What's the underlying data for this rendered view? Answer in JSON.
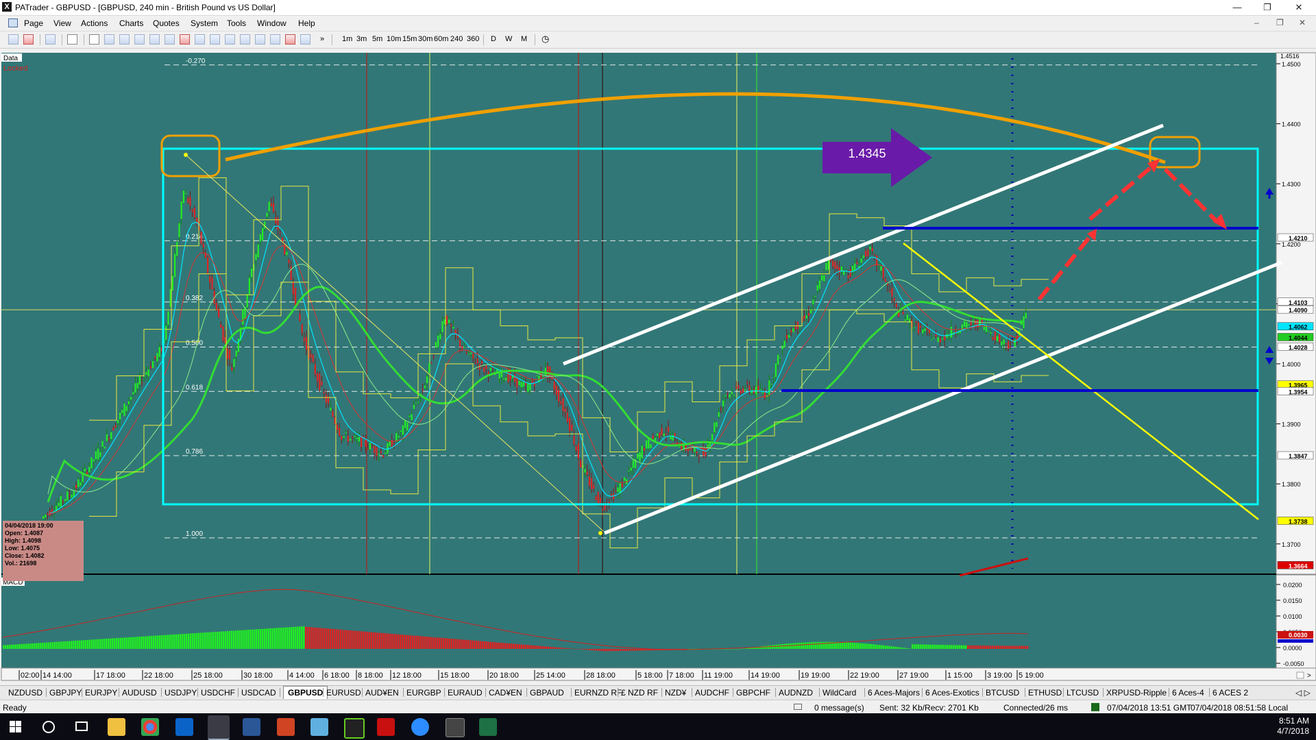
{
  "window": {
    "app_icon": "X",
    "title": "PATrader - GBPUSD - [GBPUSD, 240 min - British Pound vs US Dollar]",
    "controls": [
      "minimize-icon",
      "restore-icon",
      "close-icon"
    ]
  },
  "menu": [
    "Page",
    "View",
    "Actions",
    "Charts",
    "Quotes",
    "System",
    "Tools",
    "Window",
    "Help"
  ],
  "toolbar": {
    "timeframes": [
      "1m",
      "3m",
      "5m",
      "10m",
      "15m",
      "30m",
      "60m",
      "240",
      "360"
    ],
    "periods": [
      "D",
      "W",
      "M"
    ],
    "overflow": "»"
  },
  "chart": {
    "corner_label": "Data",
    "locked_label": "Locked",
    "fib_levels": [
      {
        "label": "-0.270",
        "price": 1.4498
      },
      {
        "label": "0.214",
        "price": 1.4205
      },
      {
        "label": "0.382",
        "price": 1.4103
      },
      {
        "label": "0.500",
        "price": 1.4028
      },
      {
        "label": "0.618",
        "price": 1.3954
      },
      {
        "label": "0.786",
        "price": 1.3847
      },
      {
        "label": "1.000",
        "price": 1.371
      }
    ],
    "callout_price": "1.4345",
    "price_axis": {
      "top_value": "1.4516",
      "ticks": [
        "1.4500",
        "1.4400",
        "1.4300",
        "1.4200",
        "1.4100",
        "1.4000",
        "1.3900",
        "1.3800",
        "1.3700"
      ],
      "tick_values": [
        1.45,
        1.44,
        1.43,
        1.42,
        1.41,
        1.4,
        1.39,
        1.38,
        1.37
      ],
      "labels": [
        {
          "text": "1.4210",
          "price": 1.421,
          "bg": "#ffffff",
          "fg": "#000000"
        },
        {
          "text": "1.4103",
          "price": 1.4103,
          "bg": "#ffffff",
          "fg": "#000000"
        },
        {
          "text": "1.4090",
          "price": 1.409,
          "bg": "#ffffff",
          "fg": "#000000"
        },
        {
          "text": "1.4062",
          "price": 1.4062,
          "bg": "#00e5ff",
          "fg": "#000000"
        },
        {
          "text": "1.4044",
          "price": 1.4044,
          "bg": "#22cc22",
          "fg": "#000000"
        },
        {
          "text": "1.4028",
          "price": 1.4028,
          "bg": "#ffffff",
          "fg": "#000000"
        },
        {
          "text": "1.3965",
          "price": 1.3965,
          "bg": "#ffff00",
          "fg": "#000000"
        },
        {
          "text": "1.3954",
          "price": 1.3954,
          "bg": "#ffffff",
          "fg": "#000000"
        },
        {
          "text": "1.3847",
          "price": 1.3847,
          "bg": "#ffffff",
          "fg": "#000000"
        },
        {
          "text": "1.3738",
          "price": 1.3738,
          "bg": "#ffff00",
          "fg": "#000000"
        },
        {
          "text": "1.3664",
          "price": 1.3664,
          "bg": "#dd0000",
          "fg": "#ffffff"
        }
      ]
    },
    "info_box": {
      "date": "04/04/2018 19:00",
      "open": "Open: 1.4087",
      "high": "High: 1.4098",
      "low": "Low: 1.4075",
      "close": "Close: 1.4082",
      "volume": "Vol.: 21698"
    },
    "macd": {
      "label": "MACD",
      "ticks": [
        "0.0200",
        "0.0150",
        "0.0100",
        "0.0050",
        "0.0000",
        "-0.0050"
      ],
      "current_value": "0.0030"
    },
    "time_axis": [
      "02:00",
      "14 14:00",
      "17 18:00",
      "22 18:00",
      "25 18:00",
      "30 18:00",
      "4 14:00",
      "6 18:00",
      "8 18:00",
      "12 18:00",
      "15 18:00",
      "20 18:00",
      "25 14:00",
      "28 18:00",
      "5 18:00",
      "7 18:00",
      "11 19:00",
      "14 19:00",
      "19 19:00",
      "22 19:00",
      "27 19:00",
      "1 15:00",
      "3 19:00",
      "5 19:00"
    ],
    "colors": {
      "background": "#327777",
      "bull": "#22ee22",
      "bear": "#dd2222",
      "box": "#00ffff",
      "channel": "#ffffff",
      "arc": "#f0a000",
      "support": "#0000cc",
      "trend": "#ffff00",
      "arrow": "#ff3333",
      "callout": "#6a1aa8"
    }
  },
  "symbol_tabs": [
    "NZDUSD",
    "GBPJPY",
    "EURJPY",
    "AUDUSD",
    "USDJPY",
    "USDCHF",
    "USDCAD",
    "GBPUSD",
    "EURUSD",
    "AUD¥EN",
    "EURGBP",
    "EURAUD",
    "CAD¥EN",
    "GBPAUD",
    "EURNZD RF",
    "£ NZD RF",
    "NZD¥",
    "AUDCHF",
    "GBPCHF",
    "AUDNZD",
    "WildCard",
    "6 Aces-Majors",
    "6 Aces-Exotics",
    "BTCUSD",
    "ETHUSD",
    "LTCUSD",
    "XRPUSD-Ripple",
    "6 Aces-4",
    "6 ACES 2"
  ],
  "active_tab": "GBPUSD",
  "status": {
    "ready": "Ready",
    "messages": "0 message(s)",
    "sent_recv": "Sent: 32 Kb/Recv: 2701 Kb",
    "connected": "Connected/26 ms",
    "gmt_time": "07/04/2018 13:51 GMT",
    "local_time": "07/04/2018 08:51:58 Local"
  },
  "taskbar": {
    "time": "8:51 AM",
    "date": "4/7/2018"
  }
}
